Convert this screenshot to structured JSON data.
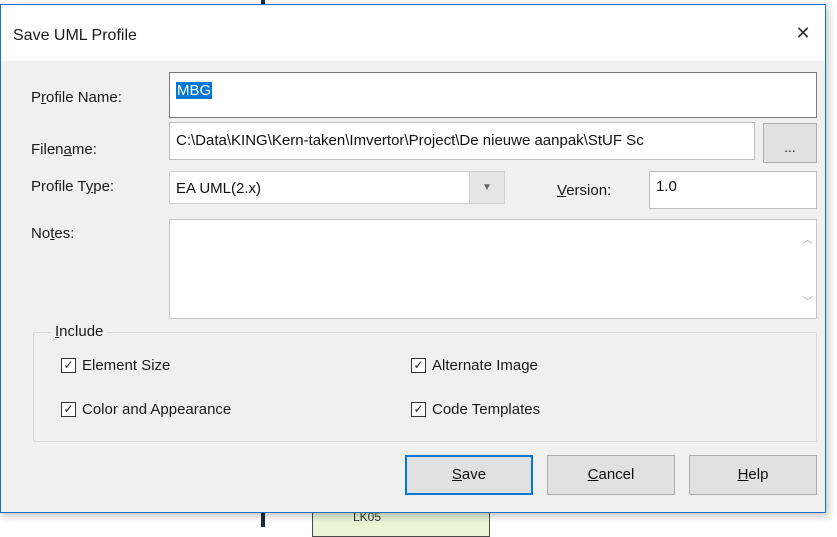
{
  "background": {
    "box_label": "LK05"
  },
  "dialog": {
    "title": "Save UML Profile",
    "close_glyph": "✕",
    "labels": {
      "profile_name": [
        "P",
        "r",
        "ofile Name:"
      ],
      "filename": [
        "Filen",
        "a",
        "me:"
      ],
      "profile_type": [
        "Profile T",
        "y",
        "pe:"
      ],
      "version": [
        "",
        "V",
        "ersion:"
      ],
      "notes": [
        "No",
        "t",
        "es:"
      ]
    },
    "profile_name_value": "MBG",
    "filename_value": "C:\\Data\\KING\\Kern-taken\\Imvertor\\Project\\De nieuwe aanpak\\StUF Sc",
    "browse_label": "...",
    "profile_type_value": "EA UML(2.x)",
    "version_value": "1.0",
    "notes_value": "",
    "include": {
      "legend": [
        "",
        "I",
        "nclude"
      ],
      "options": [
        {
          "label": "Element Size",
          "checked": true
        },
        {
          "label": "Alternate Image",
          "checked": true
        },
        {
          "label": "Color and Appearance",
          "checked": true
        },
        {
          "label": "Code Templates",
          "checked": true
        }
      ]
    },
    "buttons": {
      "save": [
        "",
        "S",
        "ave"
      ],
      "cancel": [
        "",
        "C",
        "ancel"
      ],
      "help": [
        "",
        "H",
        "elp"
      ]
    },
    "check_glyph": "✓"
  }
}
